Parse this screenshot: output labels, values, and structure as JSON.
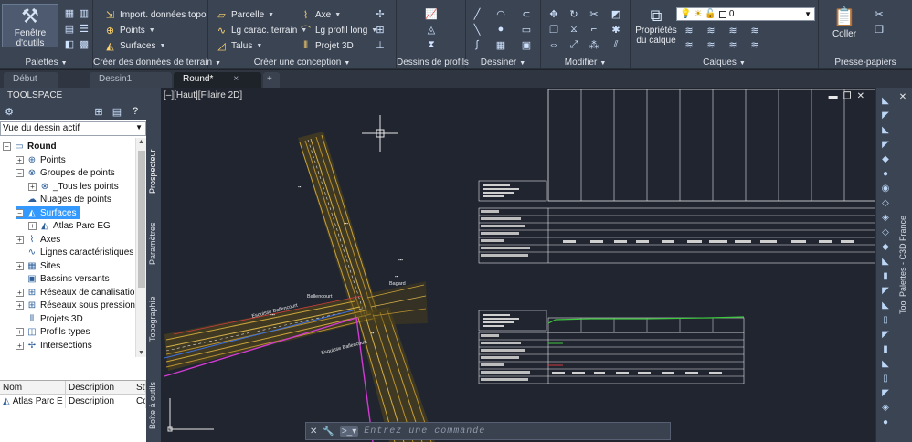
{
  "ribbon": {
    "palettes": {
      "button": "Fenêtre d'outils",
      "title": "Palettes"
    },
    "terrain": {
      "title": "Créer des données de terrain",
      "items": [
        "Import. données topo",
        "Points",
        "Surfaces"
      ]
    },
    "conception": {
      "title": "Créer une conception",
      "items": [
        "Parcelle",
        "Lg carac. terrain",
        "Talus",
        "Axe",
        "Lg profil long",
        "Projet 3D"
      ]
    },
    "profils": {
      "title": "Dessins de profils"
    },
    "dessiner": {
      "title": "Dessiner"
    },
    "modifier": {
      "title": "Modifier"
    },
    "calques": {
      "title": "Calques",
      "button": "Propriétés du calque",
      "layer_value": "0"
    },
    "presse": {
      "title": "Presse-papiers",
      "button": "Coller"
    }
  },
  "tabs": [
    {
      "label": "Début"
    },
    {
      "label": "Dessin1"
    },
    {
      "label": "Round*"
    }
  ],
  "toolspace": {
    "title": "TOOLSPACE",
    "view_select": "Vue du dessin actif",
    "tree": [
      {
        "label": "Round",
        "bold": true,
        "icon": "drawing-icon"
      },
      {
        "label": "Points",
        "icon": "points-icon"
      },
      {
        "label": "Groupes de points",
        "icon": "point-groups-icon"
      },
      {
        "label": "_Tous les points",
        "icon": "point-group-icon"
      },
      {
        "label": "Nuages de points",
        "icon": "point-cloud-icon"
      },
      {
        "label": "Surfaces",
        "icon": "surfaces-icon"
      },
      {
        "label": "Atlas Parc EG",
        "icon": "surface-icon"
      },
      {
        "label": "Axes",
        "icon": "alignments-icon"
      },
      {
        "label": "Lignes caractéristiques ...",
        "icon": "feature-lines-icon"
      },
      {
        "label": "Sites",
        "icon": "sites-icon"
      },
      {
        "label": "Bassins versants",
        "icon": "catchments-icon"
      },
      {
        "label": "Réseaux de canalisations",
        "icon": "pipe-networks-icon"
      },
      {
        "label": "Réseaux sous pression",
        "icon": "pressure-networks-icon"
      },
      {
        "label": "Projets 3D",
        "icon": "corridors-icon"
      },
      {
        "label": "Profils types",
        "icon": "assemblies-icon"
      },
      {
        "label": "Intersections",
        "icon": "intersections-icon"
      }
    ],
    "grid": {
      "headers": [
        "Nom",
        "Description",
        "Sty"
      ],
      "row": [
        "Atlas Parc E",
        "Description",
        "Co"
      ]
    },
    "side_tabs": [
      "Prospecteur",
      "Paramètres",
      "Topographie",
      "Boîte à outils"
    ]
  },
  "viewport": {
    "label": "[–][Haut][Filaire 2D]",
    "command_placeholder": "Entrez une commande",
    "street_labels": [
      "Esquisse Ballencourt",
      "Esquisse Ballencourt",
      "Ballencourt",
      "Bagard"
    ]
  },
  "right_palette": {
    "label": "Tool Palettes - C3D France"
  }
}
